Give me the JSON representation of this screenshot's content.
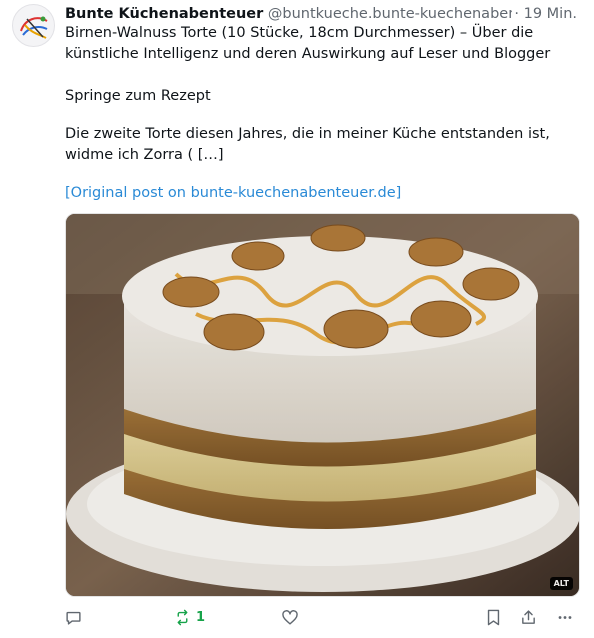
{
  "post": {
    "author_name": "Bunte Küchenabenteuer",
    "handle": "@buntkueche.bunte-kuechenabente...",
    "time": "· 19 Min.",
    "text_line_1": "Birnen-Walnuss Torte (10 Stücke, 18cm Durchmesser) – Über die\nkünstliche Intelligenz und deren Auswirkung auf Leser und Blogger",
    "text_line_2": "Springe zum Rezept",
    "text_line_3": "Die zweite Torte diesen Jahres, die in meiner Küche entstanden ist,\nwidme ich Zorra ( […]",
    "link_text": "[Original post on bunte-kuechenabenteuer.de]",
    "image_alt_badge": "ALT"
  },
  "actions": {
    "reply_icon": "reply-icon",
    "repost_icon": "repost-icon",
    "repost_count": "1",
    "like_icon": "heart-icon",
    "bookmark_icon": "bookmark-icon",
    "share_icon": "share-icon",
    "more_icon": "more-icon"
  },
  "colors": {
    "link": "#2a8ad6",
    "repost_active": "#17a34a",
    "muted": "#60676f"
  }
}
